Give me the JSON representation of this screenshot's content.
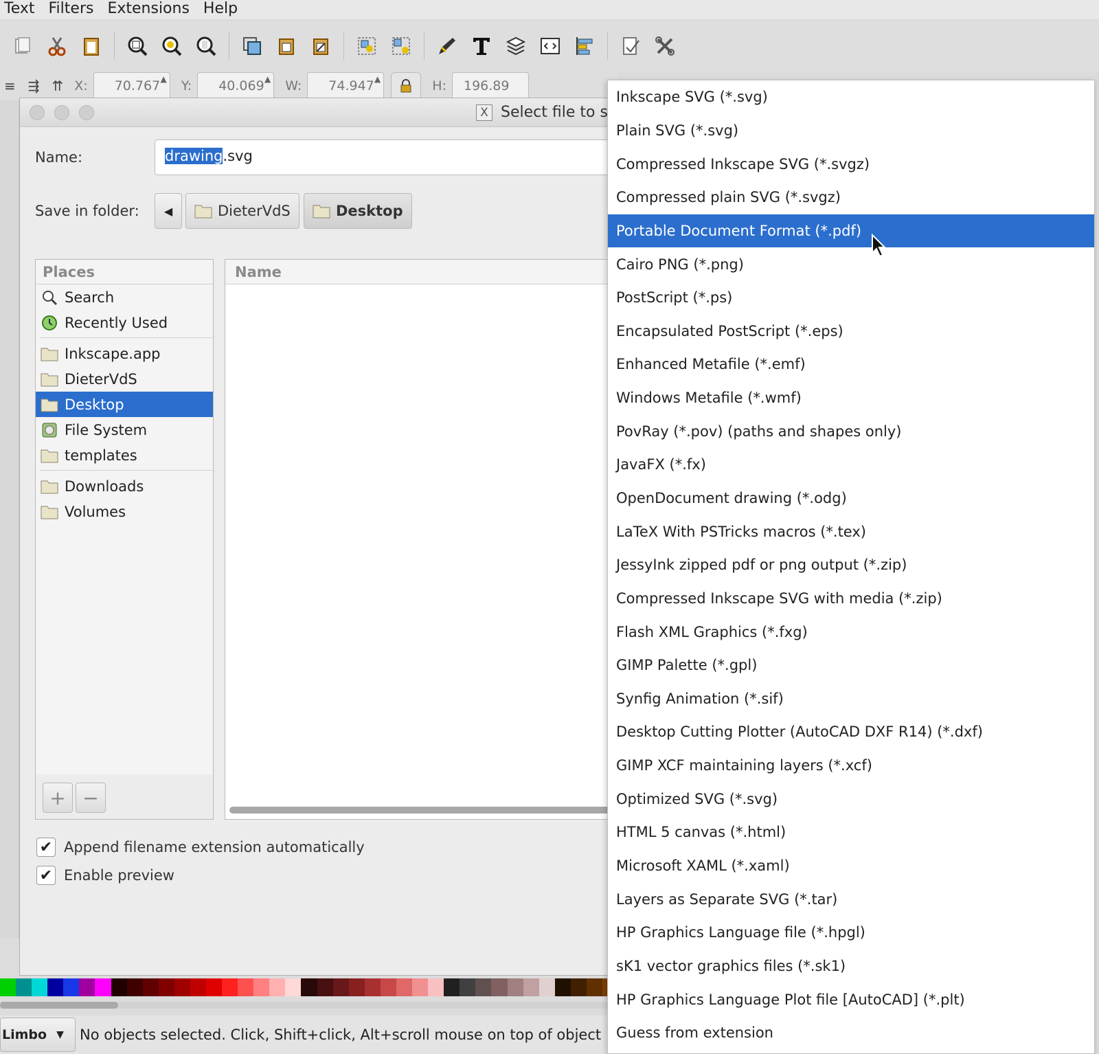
{
  "menubar": {
    "items": [
      "Text",
      "Filters",
      "Extensions",
      "Help"
    ]
  },
  "toolbar": {
    "icons": [
      "copy-icon",
      "cut-icon",
      "paste-icon",
      "zoom-selection-icon",
      "zoom-drawing-icon",
      "zoom-page-icon",
      "duplicate-icon",
      "clone-icon",
      "unlink-clone-icon",
      "group-icon",
      "ungroup-icon",
      "fill-stroke-icon",
      "text-tool-icon",
      "layers-icon",
      "xml-editor-icon",
      "align-distribute-icon",
      "document-properties-icon",
      "preferences-icon"
    ]
  },
  "coords": {
    "x_label": "X:",
    "x_value": "70.767",
    "y_label": "Y:",
    "y_value": "40.069",
    "w_label": "W:",
    "w_value": "74.947",
    "h_label": "H:",
    "h_value": "196.89"
  },
  "dialog": {
    "title": "Select file to s",
    "name_label": "Name:",
    "filename_selected": "drawing",
    "filename_rest": ".svg",
    "save_in_label": "Save in folder:",
    "breadcrumbs": [
      "DieterVdS",
      "Desktop"
    ],
    "places_header": "Places",
    "places": [
      {
        "label": "Search",
        "icon": "search-icon"
      },
      {
        "label": "Recently Used",
        "icon": "recent-icon"
      },
      {
        "label": "Inkscape.app",
        "icon": "folder-icon"
      },
      {
        "label": "DieterVdS",
        "icon": "folder-icon"
      },
      {
        "label": "Desktop",
        "icon": "folder-icon",
        "selected": true
      },
      {
        "label": "File System",
        "icon": "drive-icon"
      },
      {
        "label": "templates",
        "icon": "folder-icon"
      },
      {
        "label": "Downloads",
        "icon": "folder-icon"
      },
      {
        "label": "Volumes",
        "icon": "folder-icon"
      }
    ],
    "filelist_header": "Name",
    "add_label": "+",
    "remove_label": "−",
    "append_ext_label": "Append filename extension automatically",
    "enable_preview_label": "Enable preview",
    "check_mark": "✔"
  },
  "filetypes": {
    "selected": "Portable Document Format (*.pdf)",
    "items": [
      "Inkscape SVG (*.svg)",
      "Plain SVG (*.svg)",
      "Compressed Inkscape SVG (*.svgz)",
      "Compressed plain SVG (*.svgz)",
      "Portable Document Format (*.pdf)",
      "Cairo PNG (*.png)",
      "PostScript (*.ps)",
      "Encapsulated PostScript (*.eps)",
      "Enhanced Metafile (*.emf)",
      "Windows Metafile (*.wmf)",
      "PovRay (*.pov) (paths and shapes only)",
      "JavaFX (*.fx)",
      "OpenDocument drawing (*.odg)",
      "LaTeX With PSTricks macros (*.tex)",
      "JessyInk zipped pdf or png output (*.zip)",
      "Compressed Inkscape SVG with media (*.zip)",
      "Flash XML Graphics (*.fxg)",
      "GIMP Palette (*.gpl)",
      "Synfig Animation (*.sif)",
      "Desktop Cutting Plotter (AutoCAD DXF R14) (*.dxf)",
      "GIMP XCF maintaining layers (*.xcf)",
      "Optimized SVG (*.svg)",
      "HTML 5 canvas (*.html)",
      "Microsoft XAML (*.xaml)",
      "Layers as Separate SVG (*.tar)",
      "HP Graphics Language file (*.hpgl)",
      "sK1 vector graphics files (*.sk1)",
      "HP Graphics Language Plot file [AutoCAD] (*.plt)",
      "Guess from extension"
    ]
  },
  "statusbar": {
    "layer": "Limbo",
    "message": "No objects selected. Click, Shift+click, Alt+scroll mouse on top of object"
  },
  "palette": [
    "#00d000",
    "#009090",
    "#00d8d8",
    "#0000a0",
    "#1838e8",
    "#a000a0",
    "#ff00ff",
    "#200000",
    "#400000",
    "#600000",
    "#800000",
    "#a00000",
    "#c00000",
    "#e00000",
    "#ff2020",
    "#ff5050",
    "#ff8080",
    "#ffb0b0",
    "#ffd8d8",
    "#280808",
    "#481010",
    "#681818",
    "#882020",
    "#a83030",
    "#c84848",
    "#e06868",
    "#f09090",
    "#f8c0c0",
    "#202020",
    "#404040",
    "#605050",
    "#806060",
    "#a08080",
    "#c0a0a0",
    "#e0d0d0",
    "#201000",
    "#402000",
    "#603000",
    "#804000"
  ]
}
